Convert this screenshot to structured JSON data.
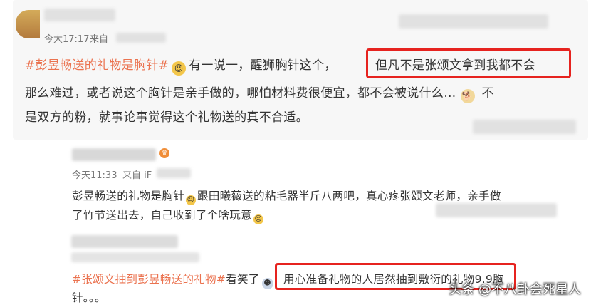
{
  "comment1": {
    "timestamp": "今大17:17",
    "source_label": "来自",
    "hashtag": "#彭昱畅送的礼物是胸针#",
    "line1_after_tag": "有一说一，醒狮胸针这个，",
    "highlight": "但凡不是张颂文拿到我都不会",
    "line2": "那么难过，或者说这个胸针是亲手做的，哪怕材料费很便宜，都不会被说什么…",
    "line2_end": "不",
    "line3": "是双方的粉，就事论事觉得这个礼物送的真不合适。"
  },
  "comment2": {
    "timestamp": "今天11:33",
    "source_label": "来自 iF",
    "line1": "彭昱畅送的礼物是胸针",
    "line1_after_emoji": "跟田曦薇送的粘毛器半斤八两吧，真心疼张颂文老师，亲手做",
    "line2": "了竹节送出去，自己收到了个啥玩意"
  },
  "comment3": {
    "hashtag": "#张颂文抽到彭昱畅送的礼物#",
    "after_tag": "看笑了",
    "highlight": "用心准备礼物的人居然抽到敷衍的礼物9.9胸",
    "line2": "针。。。"
  },
  "watermark": "头条 @不八卦会死星人",
  "colors": {
    "highlight_border": "#e6231f",
    "hashtag": "#eb7350",
    "panel_bg": "#f7f7f7"
  }
}
